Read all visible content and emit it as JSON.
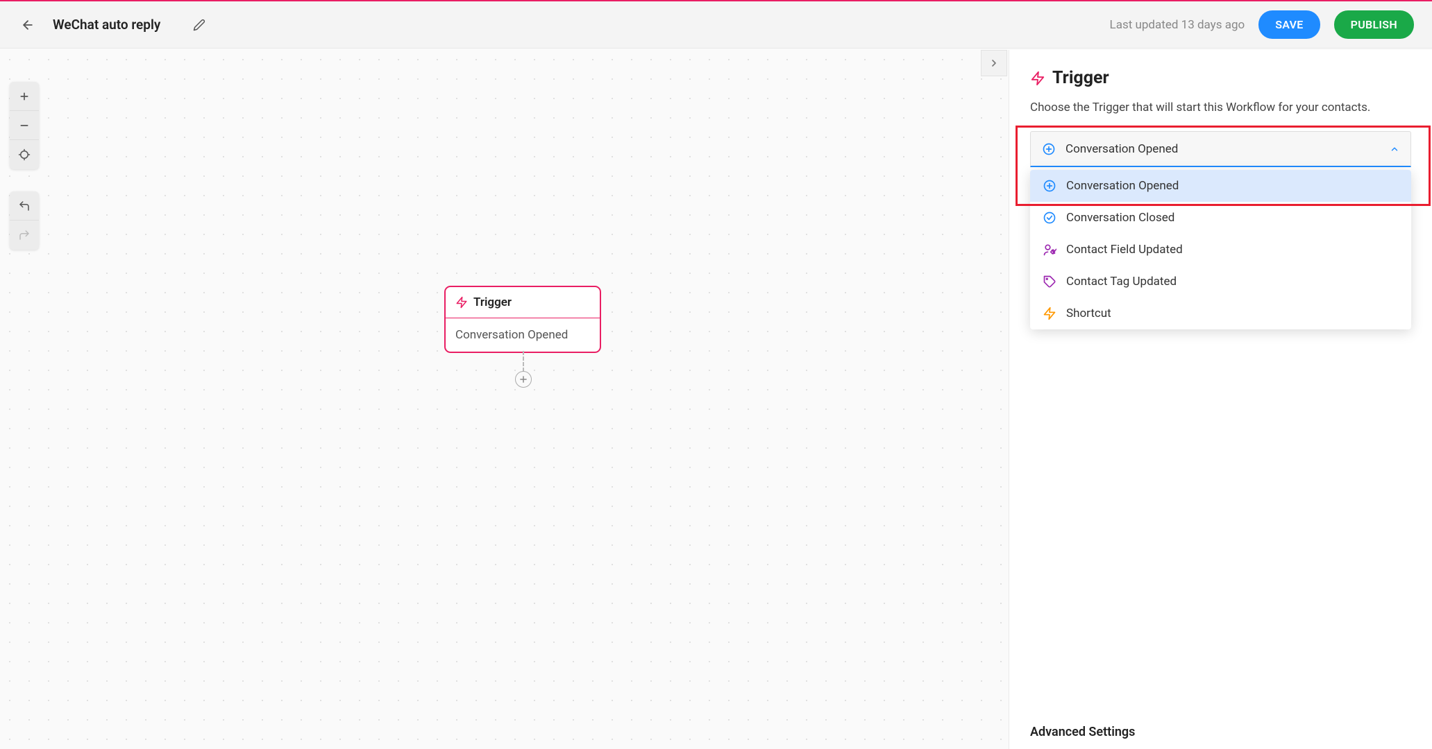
{
  "header": {
    "title": "WeChat auto reply",
    "last_updated": "Last updated 13 days ago",
    "save_label": "SAVE",
    "publish_label": "PUBLISH"
  },
  "canvas": {
    "node": {
      "title": "Trigger",
      "body": "Conversation Opened"
    }
  },
  "panel": {
    "title": "Trigger",
    "description": "Choose the Trigger that will start this Workflow for your contacts.",
    "dropdown": {
      "selected_label": "Conversation Opened",
      "options": [
        {
          "label": "Conversation Opened",
          "icon": "plus-circle",
          "color": "#1f8bff",
          "selected": true
        },
        {
          "label": "Conversation Closed",
          "icon": "check-circle",
          "color": "#1f8bff"
        },
        {
          "label": "Contact Field Updated",
          "icon": "user-edit",
          "color": "#9c27b0"
        },
        {
          "label": "Contact Tag Updated",
          "icon": "tag",
          "color": "#9c27b0"
        },
        {
          "label": "Shortcut",
          "icon": "bolt",
          "color": "#ff9800"
        }
      ]
    },
    "advanced_label": "Advanced Settings"
  }
}
